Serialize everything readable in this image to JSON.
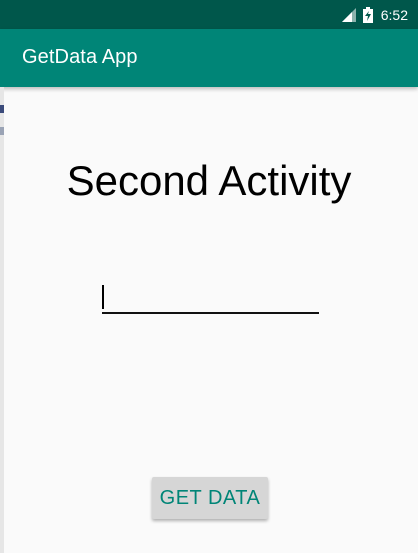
{
  "status_bar": {
    "time": "6:52",
    "icons": [
      "signal-icon",
      "battery-charging-icon"
    ]
  },
  "app_bar": {
    "title": "GetData App"
  },
  "main": {
    "heading": "Second Activity",
    "input": {
      "value": "",
      "placeholder": ""
    },
    "get_data_button": "GET DATA"
  },
  "colors": {
    "status_bar": "#00574b",
    "app_bar": "#008577",
    "accent": "#008577",
    "background": "#fafafa",
    "button_bg": "#d6d6d6"
  }
}
